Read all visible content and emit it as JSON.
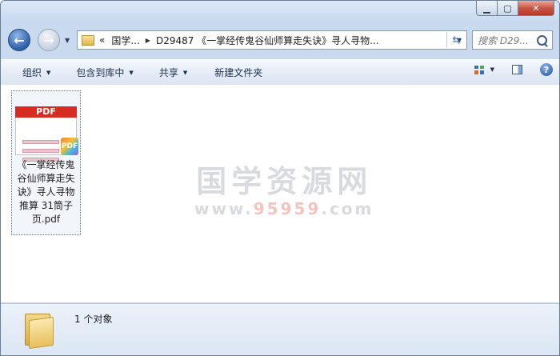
{
  "window": {
    "caption_buttons": [
      "minimize",
      "maximize",
      "close"
    ]
  },
  "navigation": {
    "back_label": "Back",
    "forward_label": "Forward",
    "address_segments": [
      "«",
      "国学...",
      "D29487 《一掌经传鬼谷仙师算走失诀》寻人寻物..."
    ],
    "search_placeholder": "搜索 D29..."
  },
  "toolbar": {
    "organize": "组织",
    "include_in_library": "包含到库中",
    "share": "共享",
    "new_folder": "新建文件夹",
    "help": "?"
  },
  "watermark": {
    "title": "国学资源网",
    "url_prefix": "www.",
    "url_highlight": "95959",
    "url_suffix": ".com"
  },
  "files": [
    {
      "badge": "PDF",
      "name": "《一掌经传鬼谷仙师算走失诀》寻人寻物推算 31筒子页.pdf",
      "type_icon": "pdf-icon"
    }
  ],
  "details": {
    "count_text": "1 个对象"
  }
}
